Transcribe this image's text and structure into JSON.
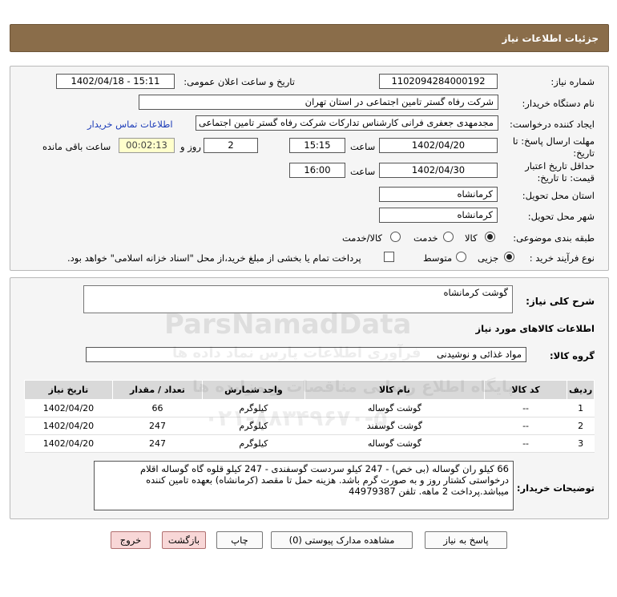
{
  "header": {
    "title": "جزئیات اطلاعات نیاز"
  },
  "form": {
    "need_number_label": "شماره نیاز:",
    "need_number": "1102094284000192",
    "announce_label": "تاریخ و ساعت اعلان عمومی:",
    "announce_value": "1402/04/18 - 15:11",
    "buyer_org_label": "نام دستگاه خریدار:",
    "buyer_org": "شرکت رفاه گستر تامین اجتماعی در استان تهران",
    "creator_label": "ایجاد کننده درخواست:",
    "creator": "مجدمهدی جعفری فرانی کارشناس تدارکات شرکت رفاه گستر تامین اجتماعی د",
    "contact_link": "اطلاعات تماس خریدار",
    "deadline_label_1": "مهلت ارسال پاسخ: تا",
    "deadline_label_2": "تاریخ:",
    "deadline_date": "1402/04/20",
    "time_label": "ساعت",
    "deadline_time": "15:15",
    "days_value": "2",
    "days_label": "روز و",
    "remaining_value": "00:02:13",
    "remaining_label": "ساعت باقی مانده",
    "validity_label_1": "حداقل تاریخ اعتبار",
    "validity_label_2": "قیمت: تا تاریخ:",
    "validity_date": "1402/04/30",
    "validity_time_label": "ساعت",
    "validity_time": "16:00",
    "province_label": "استان محل تحویل:",
    "province": "کرمانشاه",
    "city_label": "شهر محل تحویل:",
    "city": "کرمانشاه",
    "category_label": "طبقه بندی موضوعی:",
    "category_options": [
      "کالا",
      "خدمت",
      "کالا/خدمت"
    ],
    "category_selected": "کالا",
    "process_label": "نوع فرآیند خرید :",
    "process_options": [
      "جزیی",
      "متوسط"
    ],
    "process_selected": "جزیی",
    "payment_note": "پرداخت تمام یا بخشی از مبلغ خرید،از محل \"اسناد خزانه اسلامی\" خواهد بود."
  },
  "details": {
    "summary_label": "شرح کلی نیاز:",
    "summary": "گوشت کرمانشاه",
    "goods_section_title": "اطلاعات کالاهای مورد نیاز",
    "goods_group_label": "گروه کالا:",
    "goods_group": "مواد غذائی و نوشیدنی",
    "table": {
      "headers": [
        "ردیف",
        "کد کالا",
        "نام کالا",
        "واحد شمارش",
        "تعداد / مقدار",
        "تاریخ نیاز"
      ],
      "rows": [
        [
          "1",
          "--",
          "گوشت گوساله",
          "کیلوگرم",
          "66",
          "1402/04/20"
        ],
        [
          "2",
          "--",
          "گوشت گوسفند",
          "کیلوگرم",
          "247",
          "1402/04/20"
        ],
        [
          "3",
          "--",
          "گوشت گوساله",
          "کیلوگرم",
          "247",
          "1402/04/20"
        ]
      ]
    },
    "buyer_notes_label": "توضیحات خریدار:",
    "buyer_notes": "66 کیلو ران گوساله (بی خص) - 247 کیلو سردست گوسفندی - 247 کیلو قلوه گاه گوساله اقلام درخواستی کشتار روز و به صورت گرم باشد. هزینه حمل تا مقصد (کرمانشاه) بعهده تامین کننده میباشد.پرداخت 2 ماهه. تلفن 44979387"
  },
  "buttons": {
    "reply": "پاسخ به نیاز",
    "attachments": "مشاهده مدارک پیوستی (0)",
    "print": "چاپ",
    "back": "بازگشت",
    "exit": "خروج"
  },
  "watermark": {
    "brand": "ParsNamadData",
    "line1": "پایگاه اطلاع رسانی مناقصات و مزایده ها",
    "line2": "فرآوری اطلاعات پارس نماد داده ها",
    "phone": "۰۲۱-۸۸۳۴۹۶۷۰-۵"
  },
  "colors": {
    "header_bg": "#8a6d4a",
    "link": "#1b3bb8",
    "exit_button_bg": "#f8d7d7"
  }
}
